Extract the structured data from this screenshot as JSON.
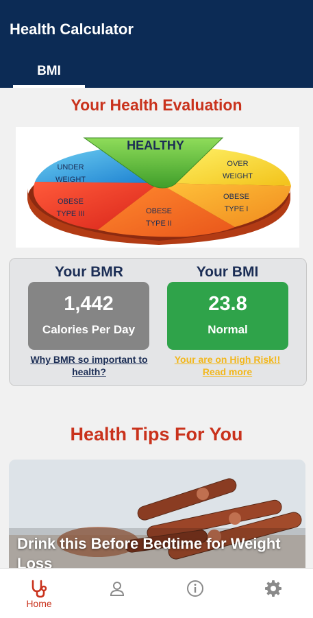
{
  "app": {
    "title": "Health Calculator"
  },
  "tabs": [
    {
      "label": "BMI",
      "active": true
    }
  ],
  "evaluation": {
    "title": "Your Health Evaluation",
    "pie_labels": {
      "healthy": "HEALTHY",
      "under_1": "UNDER",
      "under_2": "WEIGHT",
      "over_1": "OVER",
      "over_2": "WEIGHT",
      "obese3_1": "OBESE",
      "obese3_2": "TYPE III",
      "obese2_1": "OBESE",
      "obese2_2": "TYPE II",
      "obese1_1": "OBESE",
      "obese1_2": "TYPE I"
    }
  },
  "bmr": {
    "heading": "Your BMR",
    "value": "1,442",
    "unit": "Calories Per Day",
    "link": "Why BMR so important to health?"
  },
  "bmi": {
    "heading": "Your BMI",
    "value": "23.8",
    "status": "Normal",
    "link": "Your are on High Risk!! Read more"
  },
  "tips": {
    "title": "Health Tips For You",
    "card_title": "Drink this Before Bedtime for Weight Loss"
  },
  "nav": {
    "home_label": "Home"
  },
  "colors": {
    "appbar": "#0c2b55",
    "accent": "#c9321c",
    "bmr_box": "#858585",
    "bmi_box": "#2fa34a",
    "link_blue": "#1b2d55",
    "link_yellow": "#f2b71c"
  }
}
